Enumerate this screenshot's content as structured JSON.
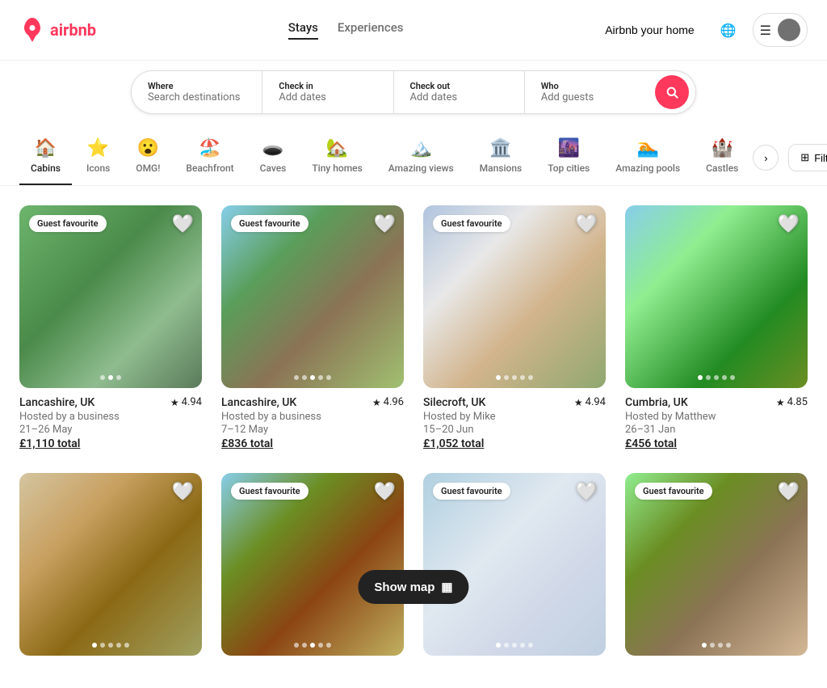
{
  "header": {
    "logo_text": "airbnb",
    "nav": {
      "stays": "Stays",
      "experiences": "Experiences"
    },
    "actions": {
      "airbnb_home": "Airbnb your home",
      "menu_icon": "☰",
      "globe_icon": "🌐"
    }
  },
  "search_bar": {
    "where_label": "Where",
    "where_placeholder": "Search destinations",
    "checkin_label": "Check in",
    "checkin_placeholder": "Add dates",
    "checkout_label": "Check out",
    "checkout_placeholder": "Add dates",
    "who_label": "Who",
    "who_placeholder": "Add guests"
  },
  "categories": [
    {
      "id": "cabins",
      "icon": "🏠",
      "label": "Cabins",
      "active": true
    },
    {
      "id": "icons",
      "icon": "⭐",
      "label": "Icons",
      "active": false
    },
    {
      "id": "omg",
      "icon": "😮",
      "label": "OMG!",
      "active": false
    },
    {
      "id": "beachfront",
      "icon": "🏖️",
      "label": "Beachfront",
      "active": false
    },
    {
      "id": "caves",
      "icon": "🕳️",
      "label": "Caves",
      "active": false
    },
    {
      "id": "tiny-homes",
      "icon": "🏡",
      "label": "Tiny homes",
      "active": false
    },
    {
      "id": "amazing-views",
      "icon": "🏔️",
      "label": "Amazing views",
      "active": false
    },
    {
      "id": "mansions",
      "icon": "🏛️",
      "label": "Mansions",
      "active": false
    },
    {
      "id": "top-cities",
      "icon": "🌆",
      "label": "Top cities",
      "active": false
    },
    {
      "id": "amazing-pools",
      "icon": "🏊",
      "label": "Amazing pools",
      "active": false
    },
    {
      "id": "castles",
      "icon": "🏰",
      "label": "Castles",
      "active": false
    }
  ],
  "filters_label": "Filters",
  "listings": [
    {
      "id": 1,
      "guest_favourite": true,
      "location": "Lancashire, UK",
      "rating": "4.94",
      "host": "Hosted by a business",
      "dates": "21–26 May",
      "price": "£1,110 total",
      "img_class": "img-1",
      "dots": 3,
      "active_dot": 1
    },
    {
      "id": 2,
      "guest_favourite": true,
      "location": "Lancashire, UK",
      "rating": "4.96",
      "host": "Hosted by a business",
      "dates": "7–12 May",
      "price": "£836 total",
      "img_class": "img-2",
      "dots": 5,
      "active_dot": 2
    },
    {
      "id": 3,
      "guest_favourite": true,
      "location": "Silecroft, UK",
      "rating": "4.94",
      "host": "Hosted by Mike",
      "dates": "15–20 Jun",
      "price": "£1,052 total",
      "img_class": "img-3",
      "dots": 5,
      "active_dot": 0
    },
    {
      "id": 4,
      "guest_favourite": false,
      "location": "Cumbria, UK",
      "rating": "4.85",
      "host": "Hosted by Matthew",
      "dates": "26–31 Jan",
      "price": "£456 total",
      "img_class": "img-4",
      "dots": 5,
      "active_dot": 0
    },
    {
      "id": 5,
      "guest_favourite": false,
      "location": "",
      "rating": "",
      "host": "",
      "dates": "",
      "price": "",
      "img_class": "img-5",
      "dots": 5,
      "active_dot": 0
    },
    {
      "id": 6,
      "guest_favourite": true,
      "location": "",
      "rating": "",
      "host": "",
      "dates": "",
      "price": "",
      "img_class": "img-6",
      "dots": 5,
      "active_dot": 2
    },
    {
      "id": 7,
      "guest_favourite": true,
      "location": "",
      "rating": "",
      "host": "",
      "dates": "",
      "price": "",
      "img_class": "img-7",
      "dots": 5,
      "active_dot": 0
    },
    {
      "id": 8,
      "guest_favourite": true,
      "location": "",
      "rating": "",
      "host": "",
      "dates": "",
      "price": "",
      "img_class": "img-8",
      "dots": 4,
      "active_dot": 0
    }
  ],
  "show_map": {
    "label": "Show map",
    "icon": "🗺️"
  },
  "guest_favourite_text": "Guest favourite",
  "wishlist_heart": "♡",
  "wishlist_heart_filled": "🤍",
  "star": "★",
  "nav_arrow": "›",
  "filters_icon": "⊞"
}
